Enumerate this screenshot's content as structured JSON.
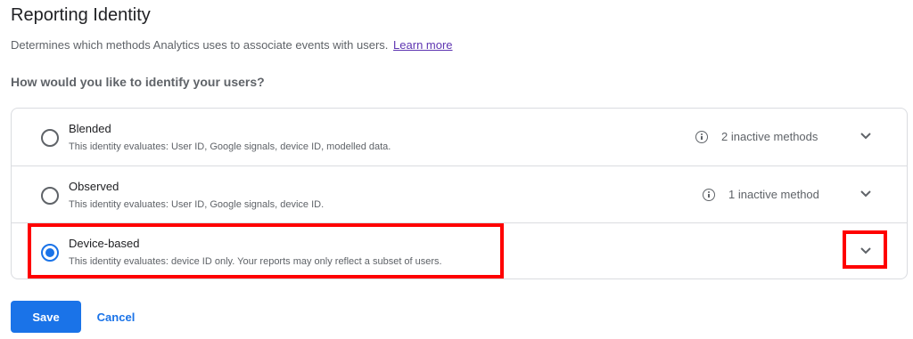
{
  "header": {
    "title": "Reporting Identity",
    "subtitle": "Determines which methods Analytics uses to associate events with users.",
    "learn_more": "Learn more"
  },
  "question": "How would you like to identify your users?",
  "options": [
    {
      "label": "Blended",
      "description": "This identity evaluates: User ID, Google signals, device ID, modelled data.",
      "inactive": "2 inactive methods",
      "selected": false
    },
    {
      "label": "Observed",
      "description": "This identity evaluates: User ID, Google signals, device ID.",
      "inactive": "1 inactive method",
      "selected": false
    },
    {
      "label": "Device-based",
      "description": "This identity evaluates: device ID only. Your reports may only reflect a subset of users.",
      "inactive": "",
      "selected": true
    }
  ],
  "actions": {
    "save_label": "Save",
    "cancel_label": "Cancel"
  },
  "colors": {
    "accent": "#1a73e8",
    "highlight": "#ff0000",
    "link": "#5e35b1"
  },
  "icons": {
    "info": "info-icon",
    "expand": "chevron-down-icon"
  }
}
